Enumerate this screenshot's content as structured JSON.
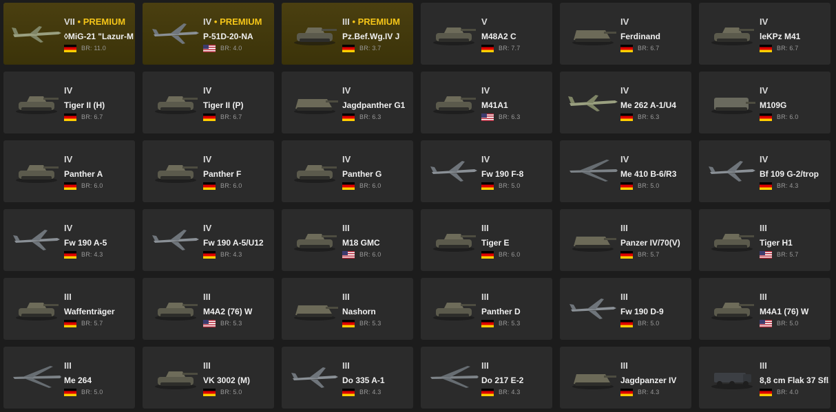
{
  "premium_label": "PREMIUM",
  "br_prefix": "BR:",
  "vehicles": [
    {
      "tier": "VII",
      "premium": true,
      "name": "◊MiG-21 \"Lazur-M",
      "flag": "de",
      "br": "11.0",
      "icon": "jet-icon"
    },
    {
      "tier": "IV",
      "premium": true,
      "name": "P-51D-20-NA",
      "flag": "us",
      "br": "4.0",
      "icon": "plane-icon"
    },
    {
      "tier": "III",
      "premium": true,
      "name": "Pz.Bef.Wg.IV J",
      "flag": "de",
      "br": "3.7",
      "icon": "tank-icon"
    },
    {
      "tier": "V",
      "premium": false,
      "name": "M48A2 C",
      "flag": "de",
      "br": "7.7",
      "icon": "tank-icon"
    },
    {
      "tier": "IV",
      "premium": false,
      "name": "Ferdinand",
      "flag": "de",
      "br": "6.7",
      "icon": "tank-destroyer-icon"
    },
    {
      "tier": "IV",
      "premium": false,
      "name": "leKPz M41",
      "flag": "de",
      "br": "6.7",
      "icon": "tank-icon"
    },
    {
      "tier": "IV",
      "premium": false,
      "name": "Tiger II (H)",
      "flag": "de",
      "br": "6.7",
      "icon": "tank-icon"
    },
    {
      "tier": "IV",
      "premium": false,
      "name": "Tiger II (P)",
      "flag": "de",
      "br": "6.7",
      "icon": "tank-icon"
    },
    {
      "tier": "IV",
      "premium": false,
      "name": "Jagdpanther G1",
      "flag": "de",
      "br": "6.3",
      "icon": "tank-destroyer-icon"
    },
    {
      "tier": "IV",
      "premium": false,
      "name": "M41A1",
      "flag": "us",
      "br": "6.3",
      "icon": "tank-icon"
    },
    {
      "tier": "IV",
      "premium": false,
      "name": "Me 262 A-1/U4",
      "flag": "de",
      "br": "6.3",
      "icon": "jet-icon"
    },
    {
      "tier": "IV",
      "premium": false,
      "name": "M109G",
      "flag": "de",
      "br": "6.0",
      "icon": "spg-icon"
    },
    {
      "tier": "IV",
      "premium": false,
      "name": "Panther A",
      "flag": "de",
      "br": "6.0",
      "icon": "tank-icon"
    },
    {
      "tier": "IV",
      "premium": false,
      "name": "Panther F",
      "flag": "de",
      "br": "6.0",
      "icon": "tank-icon"
    },
    {
      "tier": "IV",
      "premium": false,
      "name": "Panther G",
      "flag": "de",
      "br": "6.0",
      "icon": "tank-icon"
    },
    {
      "tier": "IV",
      "premium": false,
      "name": "Fw 190 F-8",
      "flag": "de",
      "br": "5.0",
      "icon": "plane-icon"
    },
    {
      "tier": "IV",
      "premium": false,
      "name": "Me 410 B-6/R3",
      "flag": "de",
      "br": "5.0",
      "icon": "bomber-icon"
    },
    {
      "tier": "IV",
      "premium": false,
      "name": "Bf 109 G-2/trop",
      "flag": "de",
      "br": "4.3",
      "icon": "plane-icon"
    },
    {
      "tier": "IV",
      "premium": false,
      "name": "Fw 190 A-5",
      "flag": "de",
      "br": "4.3",
      "icon": "plane-icon"
    },
    {
      "tier": "IV",
      "premium": false,
      "name": "Fw 190 A-5/U12",
      "flag": "de",
      "br": "4.3",
      "icon": "plane-icon"
    },
    {
      "tier": "III",
      "premium": false,
      "name": "M18 GMC",
      "flag": "us",
      "br": "6.0",
      "icon": "tank-icon"
    },
    {
      "tier": "III",
      "premium": false,
      "name": "Tiger E",
      "flag": "de",
      "br": "6.0",
      "icon": "tank-icon"
    },
    {
      "tier": "III",
      "premium": false,
      "name": "Panzer IV/70(V)",
      "flag": "de",
      "br": "5.7",
      "icon": "tank-destroyer-icon"
    },
    {
      "tier": "III",
      "premium": false,
      "name": "Tiger H1",
      "flag": "us",
      "br": "5.7",
      "icon": "tank-icon"
    },
    {
      "tier": "III",
      "premium": false,
      "name": "Waffenträger",
      "flag": "de",
      "br": "5.7",
      "icon": "tank-icon"
    },
    {
      "tier": "III",
      "premium": false,
      "name": "M4A2 (76) W",
      "flag": "us",
      "br": "5.3",
      "icon": "tank-icon"
    },
    {
      "tier": "III",
      "premium": false,
      "name": "Nashorn",
      "flag": "de",
      "br": "5.3",
      "icon": "tank-destroyer-icon"
    },
    {
      "tier": "III",
      "premium": false,
      "name": "Panther D",
      "flag": "de",
      "br": "5.3",
      "icon": "tank-icon"
    },
    {
      "tier": "III",
      "premium": false,
      "name": "Fw 190 D-9",
      "flag": "de",
      "br": "5.0",
      "icon": "plane-icon"
    },
    {
      "tier": "III",
      "premium": false,
      "name": "M4A1 (76) W",
      "flag": "us",
      "br": "5.0",
      "icon": "tank-icon"
    },
    {
      "tier": "III",
      "premium": false,
      "name": "Me 264",
      "flag": "de",
      "br": "5.0",
      "icon": "bomber-icon"
    },
    {
      "tier": "III",
      "premium": false,
      "name": "VK 3002 (M)",
      "flag": "de",
      "br": "5.0",
      "icon": "tank-icon"
    },
    {
      "tier": "III",
      "premium": false,
      "name": "Do 335 A-1",
      "flag": "de",
      "br": "4.3",
      "icon": "plane-icon"
    },
    {
      "tier": "III",
      "premium": false,
      "name": "Do 217 E-2",
      "flag": "de",
      "br": "4.3",
      "icon": "bomber-icon"
    },
    {
      "tier": "III",
      "premium": false,
      "name": "Jagdpanzer IV",
      "flag": "de",
      "br": "4.3",
      "icon": "tank-destroyer-icon"
    },
    {
      "tier": "III",
      "premium": false,
      "name": "8,8 cm Flak 37 Sfl.",
      "flag": "de",
      "br": "4.0",
      "icon": "truck-icon"
    }
  ],
  "colors": {
    "card_bg": "#2b2b2b",
    "premium_bg": "#3f360c",
    "premium_text": "#f5c518",
    "page_bg": "#1c1c1c"
  }
}
